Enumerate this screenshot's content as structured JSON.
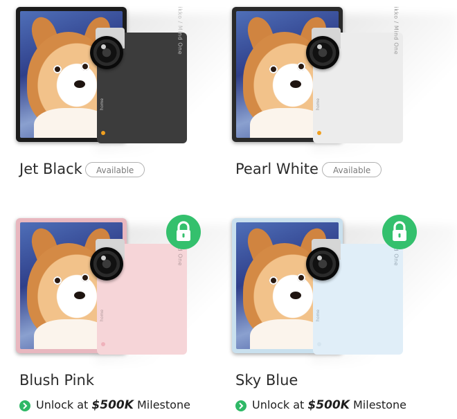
{
  "products": [
    {
      "name": "Jet Black",
      "status": "Available",
      "locked": false,
      "tablet_color": "#1c1c1c",
      "phone_color": "#3c3c3c",
      "phone_text_color": "#bdbdbd",
      "brand_text": "ikko / Mind One",
      "home_text": "home",
      "dot_color": "#f0a020"
    },
    {
      "name": "Pearl White",
      "status": "Available",
      "locked": false,
      "tablet_color": "#2a2a2a",
      "phone_color": "#ececec",
      "phone_text_color": "#9a9a9a",
      "brand_text": "ikko / Mind One",
      "home_text": "home",
      "dot_color": "#f0a020"
    },
    {
      "name": "Blush Pink",
      "locked": true,
      "unlock_prefix": "Unlock at",
      "unlock_amount": "$500K",
      "unlock_suffix": "Milestone",
      "tablet_color": "#e8b7bf",
      "phone_color": "#f6d5d8",
      "phone_text_color": "#b39a9d",
      "brand_text": "ikko / Mind One",
      "home_text": "home",
      "dot_color": "#efb2bb"
    },
    {
      "name": "Sky Blue",
      "locked": true,
      "unlock_prefix": "Unlock at",
      "unlock_amount": "$500K",
      "unlock_suffix": "Milestone",
      "tablet_color": "#c9e0ee",
      "phone_color": "#e0eef8",
      "phone_text_color": "#9aaab6",
      "brand_text": "ikko / Mind One",
      "home_text": "home",
      "dot_color": "#d5e5f0"
    }
  ],
  "colors": {
    "lock_badge": "#34c06d",
    "unlock_icon": "#2fb866"
  }
}
